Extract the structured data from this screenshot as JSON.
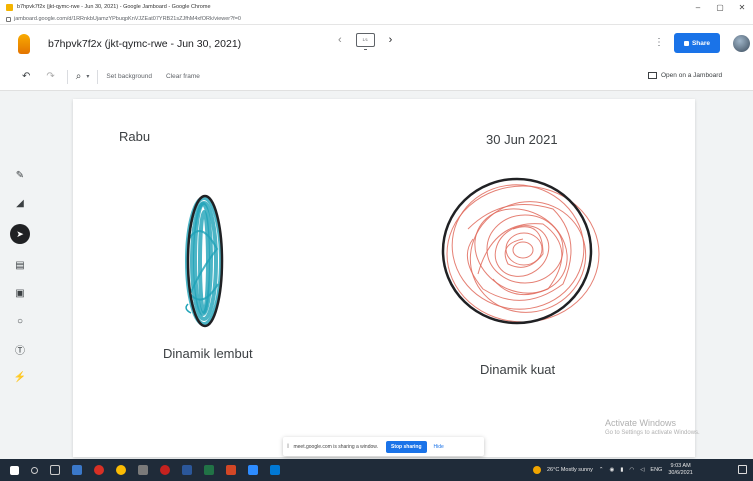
{
  "browser": {
    "tab_title": "b7hpvk7f2x (jkt-qymc-rwe - Jun 30, 2021) - Google Jamboard - Google Chrome",
    "url": "jamboard.google.com/d/1RRnkbUjamzYPbuqpKnVJZEat07YRB21sZJfhM4xfORk/viewer?f=0",
    "minimize": "–",
    "maximize": "▢",
    "close": "✕"
  },
  "app": {
    "doc_title": "b7hpvk7f2x (jkt-qymc-rwe - Jun 30, 2021)",
    "frame_counter": "1/1",
    "share_label": "Share",
    "more_icon": "kebab-menu-icon",
    "avatar_icon": "user-avatar"
  },
  "toolbar": {
    "set_background": "Set background",
    "clear_frame": "Clear frame",
    "open_jamboard": "Open on a Jamboard"
  },
  "canvas": {
    "day_label": "Rabu",
    "date_label": "30 Jun 2021",
    "left_caption": "Dinamik lembut",
    "right_caption": "Dinamik kuat"
  },
  "tools": [
    "pen-icon",
    "eraser-icon",
    "select-icon",
    "sticky-note-icon",
    "image-icon",
    "circle-icon",
    "text-box-icon",
    "laser-icon"
  ],
  "watermark": {
    "line1": "Activate Windows",
    "line2": "Go to Settings to activate Windows."
  },
  "screen_share": {
    "message": "meet.google.com is sharing a window.",
    "stop": "Stop sharing",
    "hide": "Hide"
  },
  "taskbar": {
    "weather": "26°C  Mostly sunny",
    "lang": "ENG",
    "time": "9:03 AM",
    "date": "30/6/2021"
  },
  "colors": {
    "teal_scribble": "#1fa3b8",
    "red_scribble": "#e06a5c",
    "accent": "#1a73e8"
  }
}
